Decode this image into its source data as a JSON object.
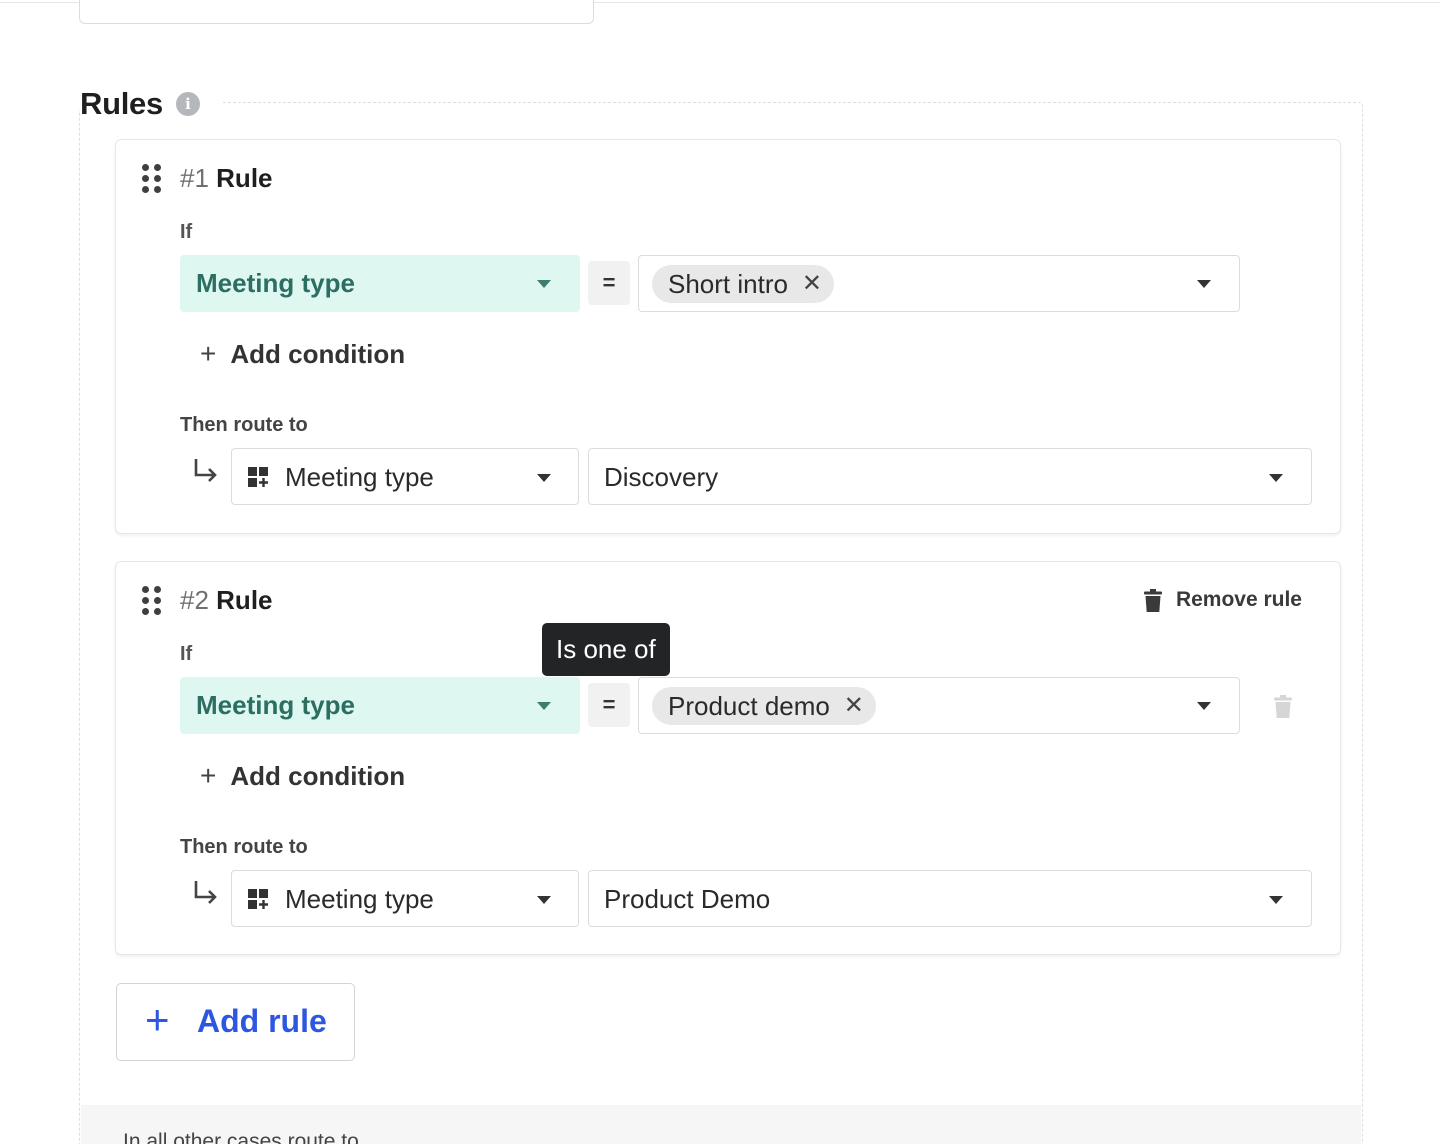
{
  "section": {
    "title": "Rules"
  },
  "rules": [
    {
      "number": "#1",
      "title": "Rule",
      "if_label": "If",
      "condition": {
        "field": "Meeting type",
        "operator": "=",
        "value_chip": "Short intro"
      },
      "add_condition_label": "Add condition",
      "then_label": "Then route to",
      "route": {
        "field": "Meeting type",
        "value": "Discovery"
      }
    },
    {
      "number": "#2",
      "title": "Rule",
      "remove_label": "Remove rule",
      "if_label": "If",
      "condition": {
        "field": "Meeting type",
        "operator": "=",
        "value_chip": "Product demo"
      },
      "add_condition_label": "Add condition",
      "then_label": "Then route to",
      "route": {
        "field": "Meeting type",
        "value": "Product Demo"
      }
    }
  ],
  "tooltip": {
    "text": "Is one of"
  },
  "add_rule_label": "Add rule",
  "fallback": {
    "label": "In all other cases route to"
  },
  "icons": {
    "info": "info-icon",
    "drag": "drag-handle-icon",
    "trash": "trash-icon",
    "grid": "grid-add-icon",
    "route_arrow": "return-arrow-icon",
    "close": "close-icon",
    "plus": "plus-icon",
    "caret": "caret-down-icon"
  },
  "colors": {
    "accent": "#2d57e0",
    "condition_field_bg": "#dff7f1",
    "condition_field_text": "#2c6e62"
  }
}
